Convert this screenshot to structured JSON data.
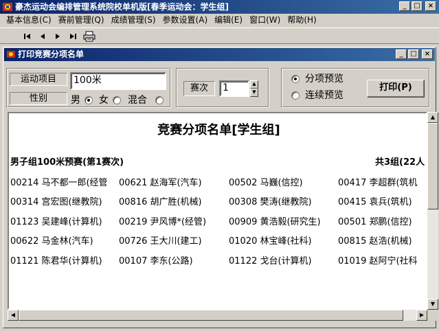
{
  "app": {
    "title": "豪杰运动会编排管理系统院校单机版[春季运动会：学生组]"
  },
  "menu": [
    {
      "label": "基本信息(C)"
    },
    {
      "label": "赛前管理(Q)"
    },
    {
      "label": "成绩管理(S)"
    },
    {
      "label": "参数设置(A)"
    },
    {
      "label": "编辑(E)"
    },
    {
      "label": "窗口(W)"
    },
    {
      "label": "帮助(H)"
    }
  ],
  "toolbar": {
    "buttons": [
      "first-page-icon",
      "prev-page-icon",
      "next-page-icon",
      "last-page-icon",
      "printer-icon"
    ]
  },
  "child_window": {
    "title": "打印竞赛分项名单"
  },
  "form": {
    "event_label": "运动项目",
    "event_value": "100米",
    "gender_label": "性别",
    "gender_options": [
      {
        "label": "男",
        "checked": true
      },
      {
        "label": "女",
        "checked": false
      },
      {
        "label": "混合",
        "checked": false
      }
    ],
    "round_label": "赛次",
    "round_value": "1",
    "preview_options": [
      {
        "label": "分项预览",
        "checked": true
      },
      {
        "label": "连续预览",
        "checked": false
      }
    ],
    "print_button": "打印(P)"
  },
  "preview": {
    "title": "竞赛分项名单[学生组]",
    "subtitle": "男子组100米预赛(第1赛次)",
    "group_count": "共3组(22人",
    "rows": [
      [
        "00214 马不都一郎(经管",
        "00621 赵海军(汽车)",
        "00502 马巍(信控)",
        "00417 李超群(筑机"
      ],
      [
        "00314 宫宏图(继教院)",
        "00816 胡广胜(机械)",
        "00308 樊涛(继教院)",
        "00415 袁兵(筑机)"
      ],
      [
        "01123 吴建峰(计算机)",
        "00219 尹风博*(经管)",
        "00909 黄浩毅(研究生)",
        "00501 郑鹏(信控)"
      ],
      [
        "00622 马金林(汽车)",
        "00726 王大川(建工)",
        "01020 林宝峰(社科)",
        "00815 赵浩(机械)"
      ],
      [
        "01121 陈君华(计算机)",
        "00107 李东(公路)",
        "01122 戈台(计算机)",
        "01019 赵阿宁(社科"
      ]
    ]
  },
  "colors": {
    "titlebar_start": "#0a246a",
    "titlebar_end": "#3a6ea5",
    "face": "#d4d0c8"
  }
}
